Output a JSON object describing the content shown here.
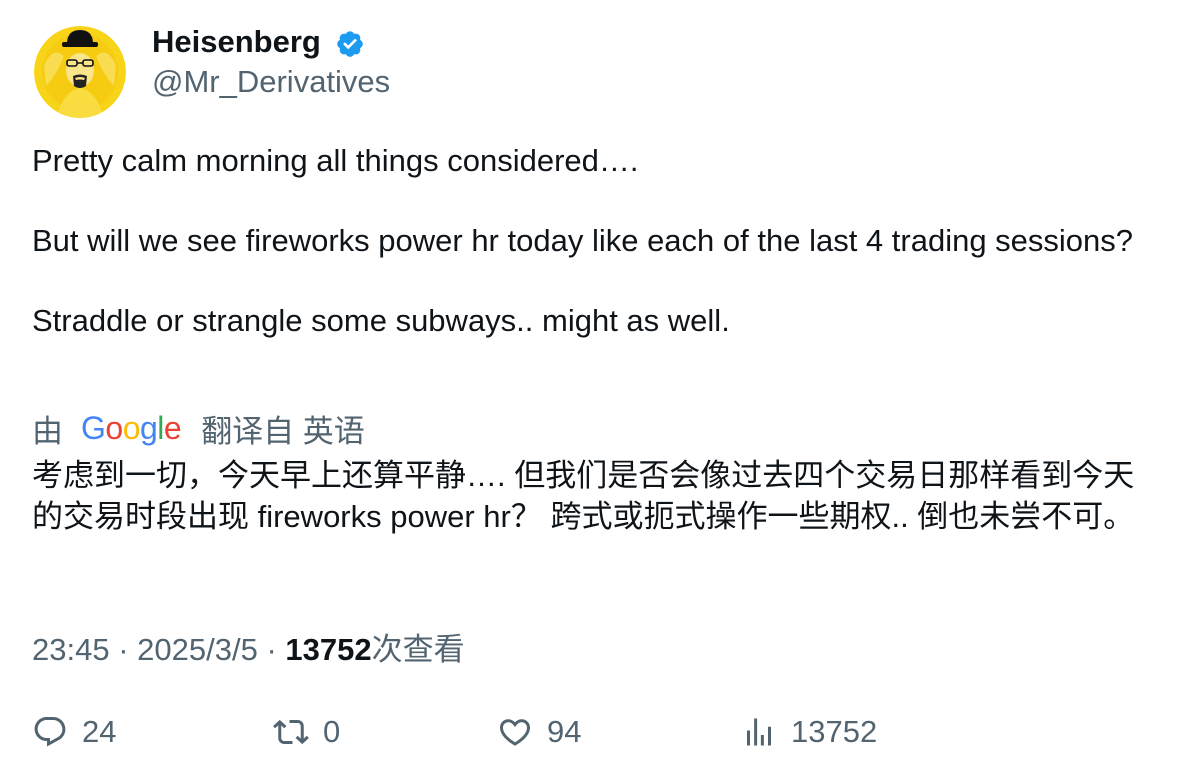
{
  "author": {
    "display_name": "Heisenberg",
    "handle": "@Mr_Derivatives",
    "verified": true,
    "avatar": "heisenberg-portrait"
  },
  "tweet": {
    "paragraphs": [
      "Pretty calm morning all things considered….",
      "But will we see fireworks power hr today like each of the last 4 trading sessions?",
      "Straddle or strangle some subways.. might as well."
    ]
  },
  "translation": {
    "by_label": "由",
    "provider": "Google",
    "from_label": "翻译自 英语",
    "text": "考虑到一切，今天早上还算平静…. 但我们是否会像过去四个交易日那样看到今天的交易时段出现 fireworks power hr？ 跨式或扼式操作一些期权.. 倒也未尝不可。"
  },
  "meta": {
    "time": "23:45",
    "date": "2025/3/5",
    "views": "13752",
    "views_label": "次查看"
  },
  "actions": {
    "replies": "24",
    "retweets": "0",
    "likes": "94",
    "views": "13752"
  },
  "colors": {
    "text": "#0f1419",
    "secondary": "#536471",
    "verified_blue": "#1d9bf0",
    "avatar_yellow": "#f7d417"
  },
  "icons": [
    "reply-icon",
    "retweet-icon",
    "like-icon",
    "views-icon",
    "verified-badge-icon"
  ]
}
